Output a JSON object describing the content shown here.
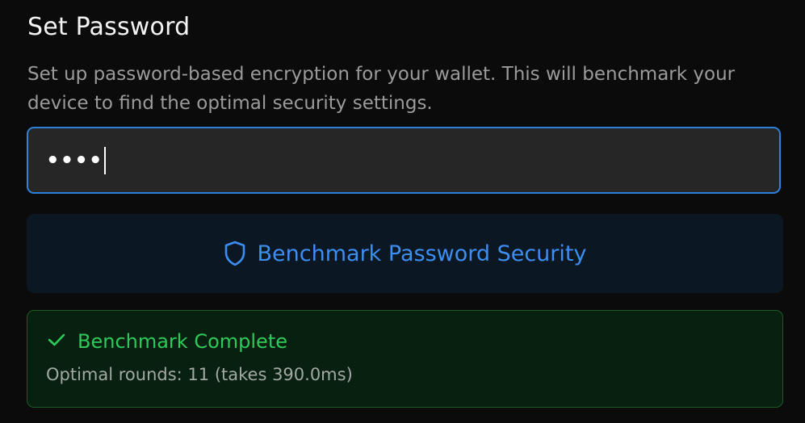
{
  "page": {
    "title": "Set Password",
    "description": "Set up password-based encryption for your wallet. This will benchmark your device to find the optimal security settings."
  },
  "password_field": {
    "value_masked": "••••",
    "focused": true
  },
  "benchmark_button": {
    "label": "Benchmark Password Security",
    "icon": "shield-icon"
  },
  "result": {
    "icon": "check-icon",
    "heading": "Benchmark Complete",
    "detail": "Optimal rounds: 11 (takes 390.0ms)"
  },
  "colors": {
    "background": "#0b0b0b",
    "accent": "#3d8ef2",
    "focus_border": "#2f80d9",
    "success": "#2ec95a"
  }
}
